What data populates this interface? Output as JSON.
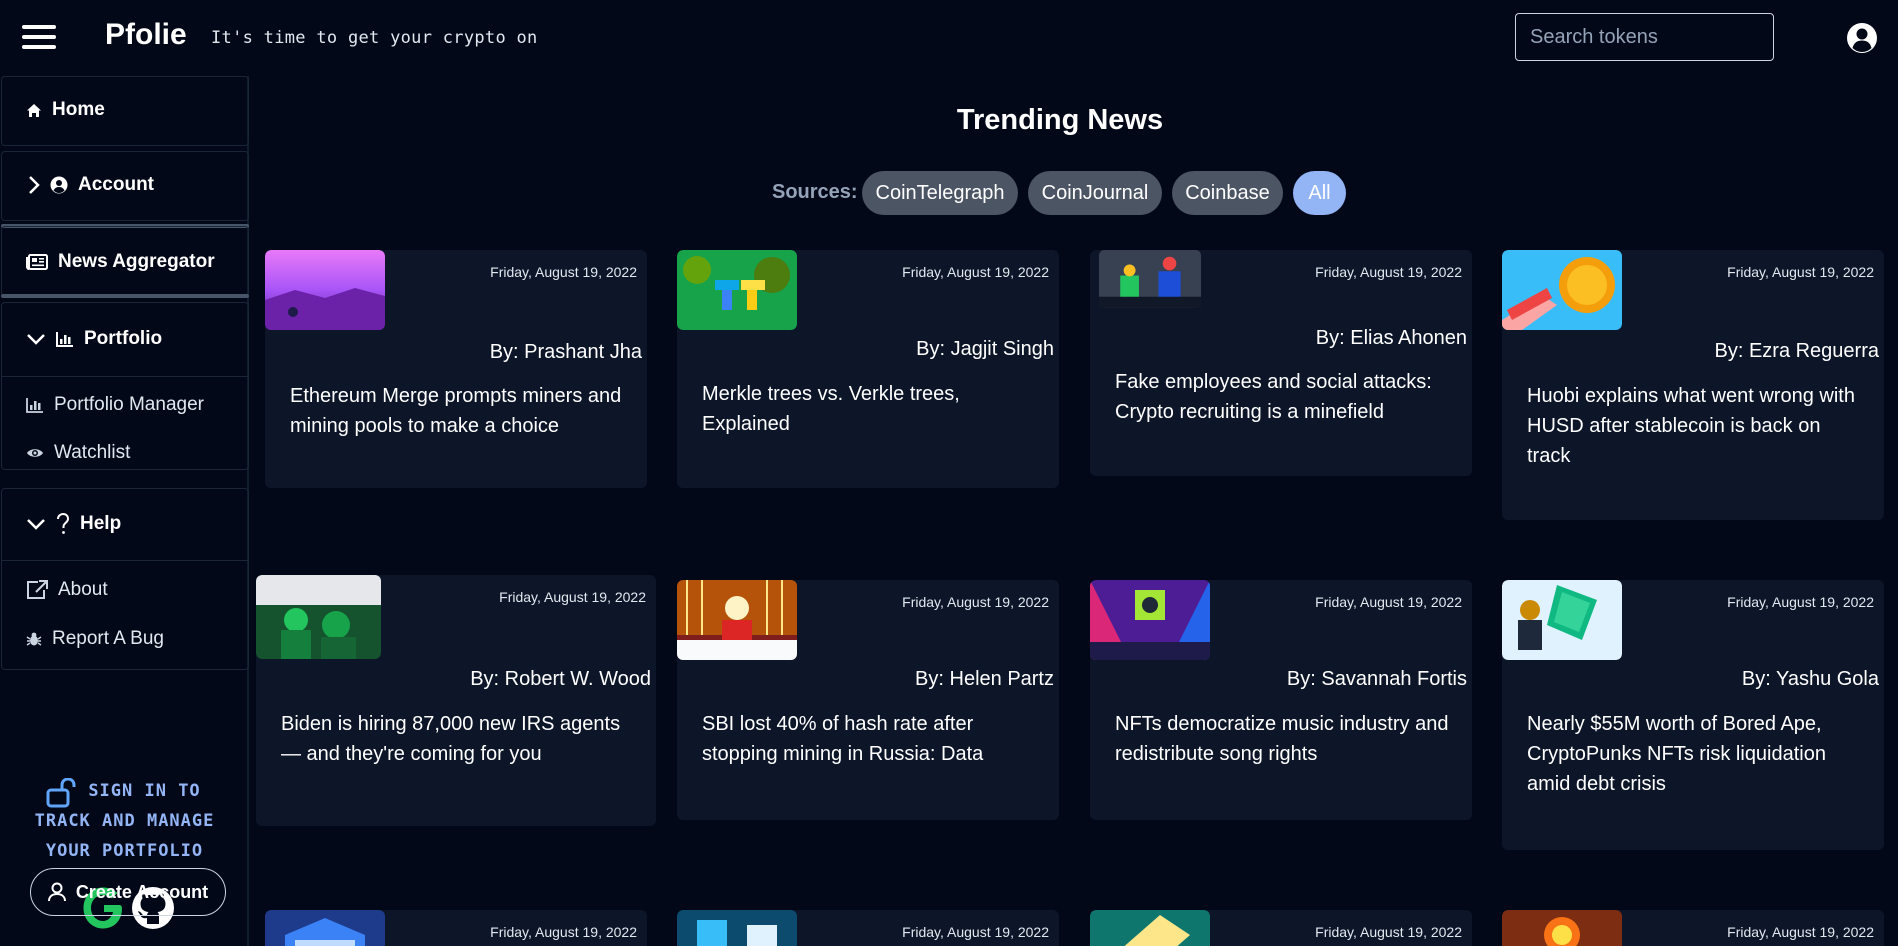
{
  "app": {
    "brand": "Pfolie",
    "tagline": "It's time to get your crypto on",
    "search_placeholder": "Search tokens"
  },
  "sidebar": {
    "home": "Home",
    "account": "Account",
    "news": "News Aggregator",
    "portfolio": "Portfolio",
    "portfolio_manager": "Portfolio Manager",
    "watchlist": "Watchlist",
    "help": "Help",
    "about": "About",
    "report_bug": "Report A Bug",
    "signin_lines": [
      "SIGN IN TO",
      "TRACK AND MANAGE",
      "YOUR PORTFOLIO"
    ],
    "create_account": "Create Account"
  },
  "main": {
    "title": "Trending News",
    "sources_label": "Sources:",
    "sources": [
      "CoinTelegraph",
      "CoinJournal",
      "Coinbase",
      "All"
    ],
    "active_source": "All"
  },
  "articles": [
    {
      "date": "Friday, August 19, 2022",
      "author": "By: Prashant Jha",
      "headline": "Ethereum Merge prompts miners and mining pools to make a choice"
    },
    {
      "date": "Friday, August 19, 2022",
      "author": "By: Jagjit Singh",
      "headline": "Merkle trees vs. Verkle trees, Explained"
    },
    {
      "date": "Friday, August 19, 2022",
      "author": "By: Elias Ahonen",
      "headline": "Fake employees and social attacks: Crypto recruiting is a minefield"
    },
    {
      "date": "Friday, August 19, 2022",
      "author": "By: Ezra Reguerra",
      "headline": "Huobi explains what went wrong with HUSD after stablecoin is back on track"
    },
    {
      "date": "Friday, August 19, 2022",
      "author": "By: Robert W. Wood",
      "headline": "Biden is hiring 87,000 new IRS agents — and they're coming for you"
    },
    {
      "date": "Friday, August 19, 2022",
      "author": "By: Helen Partz",
      "headline": "SBI lost 40% of hash rate after stopping mining in Russia: Data"
    },
    {
      "date": "Friday, August 19, 2022",
      "author": "By: Savannah Fortis",
      "headline": "NFTs democratize music industry and redistribute song rights"
    },
    {
      "date": "Friday, August 19, 2022",
      "author": "By: Yashu Gola",
      "headline": "Nearly $55M worth of Bored Ape, CryptoPunks NFTs risk liquidation amid debt crisis"
    },
    {
      "date": "Friday, August 19, 2022"
    },
    {
      "date": "Friday, August 19, 2022"
    },
    {
      "date": "Friday, August 19, 2022"
    },
    {
      "date": "Friday, August 19, 2022"
    }
  ],
  "colors": {
    "background": "#020817",
    "card": "#0c1628",
    "chip": "#4b5563",
    "chip_active": "#93b4f5",
    "signin_text": "#93b4f5",
    "google_green": "#22c55e"
  },
  "icons": [
    "menu-icon",
    "user-circle-icon",
    "home-icon",
    "chevron-right-icon",
    "account-icon",
    "newspaper-icon",
    "chevron-down-icon",
    "bar-chart-icon",
    "eye-icon",
    "question-icon",
    "external-link-icon",
    "bug-icon",
    "unlock-icon",
    "google-icon",
    "github-icon",
    "person-icon"
  ]
}
